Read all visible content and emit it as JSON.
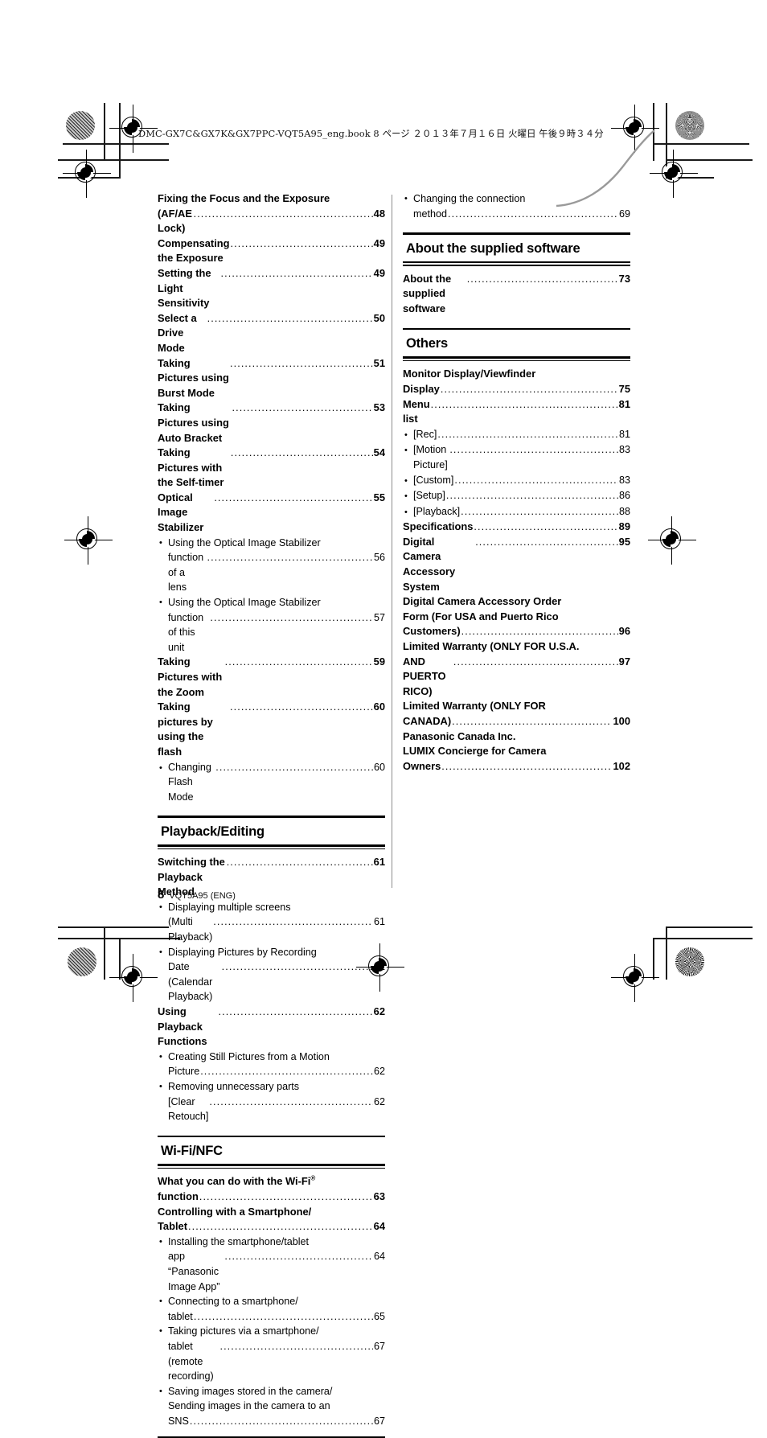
{
  "header": {
    "slug": "DMC-GX7C&GX7K&GX7PPC-VQT5A95_eng.book   8 ページ   ２０１３年７月１６日   火曜日   午後９時３４分"
  },
  "footer": {
    "page_number": "8",
    "doc_id": "VQT5A95 (ENG)"
  },
  "columns": {
    "left": [
      {
        "kind": "entries",
        "entries": [
          {
            "level": 1,
            "lines": [
              "Fixing the Focus and the Exposure",
              "(AF/AE Lock)"
            ],
            "page": "48"
          },
          {
            "level": 1,
            "lines": [
              "Compensating the Exposure"
            ],
            "page": "49"
          },
          {
            "level": 1,
            "lines": [
              "Setting the Light Sensitivity"
            ],
            "page": "49"
          },
          {
            "level": 1,
            "lines": [
              "Select a Drive Mode"
            ],
            "page": "50"
          },
          {
            "level": 1,
            "lines": [
              "Taking Pictures using Burst Mode"
            ],
            "page": "51"
          },
          {
            "level": 1,
            "lines": [
              "Taking Pictures using Auto Bracket"
            ],
            "page": "53"
          },
          {
            "level": 1,
            "lines": [
              "Taking Pictures with the Self-timer"
            ],
            "page": "54"
          },
          {
            "level": 1,
            "lines": [
              "Optical Image Stabilizer"
            ],
            "page": "55"
          },
          {
            "level": 2,
            "lines": [
              "Using the Optical Image Stabilizer",
              "function of a lens"
            ],
            "page": "56"
          },
          {
            "level": 2,
            "lines": [
              "Using the Optical Image Stabilizer",
              "function of this unit"
            ],
            "page": "57"
          },
          {
            "level": 1,
            "lines": [
              "Taking Pictures with the Zoom"
            ],
            "page": "59"
          },
          {
            "level": 1,
            "lines": [
              "Taking pictures by using the flash"
            ],
            "page": "60"
          },
          {
            "level": 2,
            "lines": [
              "Changing Flash Mode"
            ],
            "page": "60"
          }
        ]
      },
      {
        "kind": "section",
        "title": "Playback/Editing",
        "entries": [
          {
            "level": 1,
            "lines": [
              "Switching the Playback Method"
            ],
            "page": "61"
          },
          {
            "level": 2,
            "lines": [
              "Displaying multiple screens",
              "(Multi Playback)"
            ],
            "page": "61"
          },
          {
            "level": 2,
            "lines": [
              "Displaying Pictures by Recording",
              "Date (Calendar Playback)"
            ],
            "page": "61"
          },
          {
            "level": 1,
            "lines": [
              "Using Playback Functions"
            ],
            "page": "62"
          },
          {
            "level": 2,
            "lines": [
              "Creating Still Pictures from a Motion",
              "Picture"
            ],
            "page": "62"
          },
          {
            "level": 2,
            "lines": [
              "Removing unnecessary parts",
              "[Clear Retouch]"
            ],
            "page": "62"
          }
        ]
      },
      {
        "kind": "section",
        "title": "Wi-Fi/NFC",
        "entries": [
          {
            "level": 1,
            "lines": [
              "What you can do with the Wi-Fi®",
              "function"
            ],
            "page": "63",
            "sup_first_line": true
          },
          {
            "level": 1,
            "lines": [
              "Controlling with a Smartphone/",
              "Tablet"
            ],
            "page": "64"
          },
          {
            "level": 2,
            "lines": [
              "Installing the smartphone/tablet",
              "app “Panasonic Image App”"
            ],
            "page": "64"
          },
          {
            "level": 2,
            "lines": [
              "Connecting to a smartphone/",
              "tablet"
            ],
            "page": "65"
          },
          {
            "level": 2,
            "lines": [
              "Taking pictures via a smartphone/",
              "tablet (remote recording)"
            ],
            "page": "67"
          },
          {
            "level": 2,
            "lines": [
              "Saving images stored in the camera/",
              "Sending images in the camera to an",
              "SNS"
            ],
            "page": "67"
          }
        ]
      }
    ],
    "right": [
      {
        "kind": "entries",
        "entries": [
          {
            "level": 2,
            "lines": [
              "Changing the connection",
              "method"
            ],
            "page": "69"
          }
        ]
      },
      {
        "kind": "section",
        "title": "About the supplied software",
        "entries": [
          {
            "level": 1,
            "lines": [
              "About the supplied software"
            ],
            "page": "73"
          }
        ]
      },
      {
        "kind": "section",
        "title": "Others",
        "entries": [
          {
            "level": 1,
            "lines": [
              "Monitor Display/Viewfinder",
              "Display"
            ],
            "page": "75"
          },
          {
            "level": 1,
            "lines": [
              "Menu list"
            ],
            "page": "81"
          },
          {
            "level": 2,
            "lines": [
              "[Rec]"
            ],
            "page": "81"
          },
          {
            "level": 2,
            "lines": [
              "[Motion Picture]"
            ],
            "page": "83"
          },
          {
            "level": 2,
            "lines": [
              "[Custom]"
            ],
            "page": "83"
          },
          {
            "level": 2,
            "lines": [
              "[Setup]"
            ],
            "page": "86"
          },
          {
            "level": 2,
            "lines": [
              "[Playback]"
            ],
            "page": "88"
          },
          {
            "level": 1,
            "lines": [
              "Specifications"
            ],
            "page": "89"
          },
          {
            "level": 1,
            "lines": [
              "Digital Camera Accessory System"
            ],
            "page": "95"
          },
          {
            "level": 1,
            "lines": [
              "Digital Camera Accessory Order",
              "Form (For USA and Puerto Rico",
              "Customers)"
            ],
            "page": "96"
          },
          {
            "level": 1,
            "lines": [
              "Limited Warranty (ONLY FOR U.S.A.",
              "AND PUERTO RICO)"
            ],
            "page": "97"
          },
          {
            "level": 1,
            "lines": [
              "Limited Warranty (ONLY FOR",
              "CANADA)"
            ],
            "page": "100"
          },
          {
            "level": 1,
            "lines": [
              "Panasonic Canada Inc.",
              "LUMIX Concierge for Camera",
              "Owners"
            ],
            "page": "102"
          }
        ]
      }
    ]
  },
  "marks": {
    "bullet_glyph": "•",
    "leader_char": "."
  }
}
